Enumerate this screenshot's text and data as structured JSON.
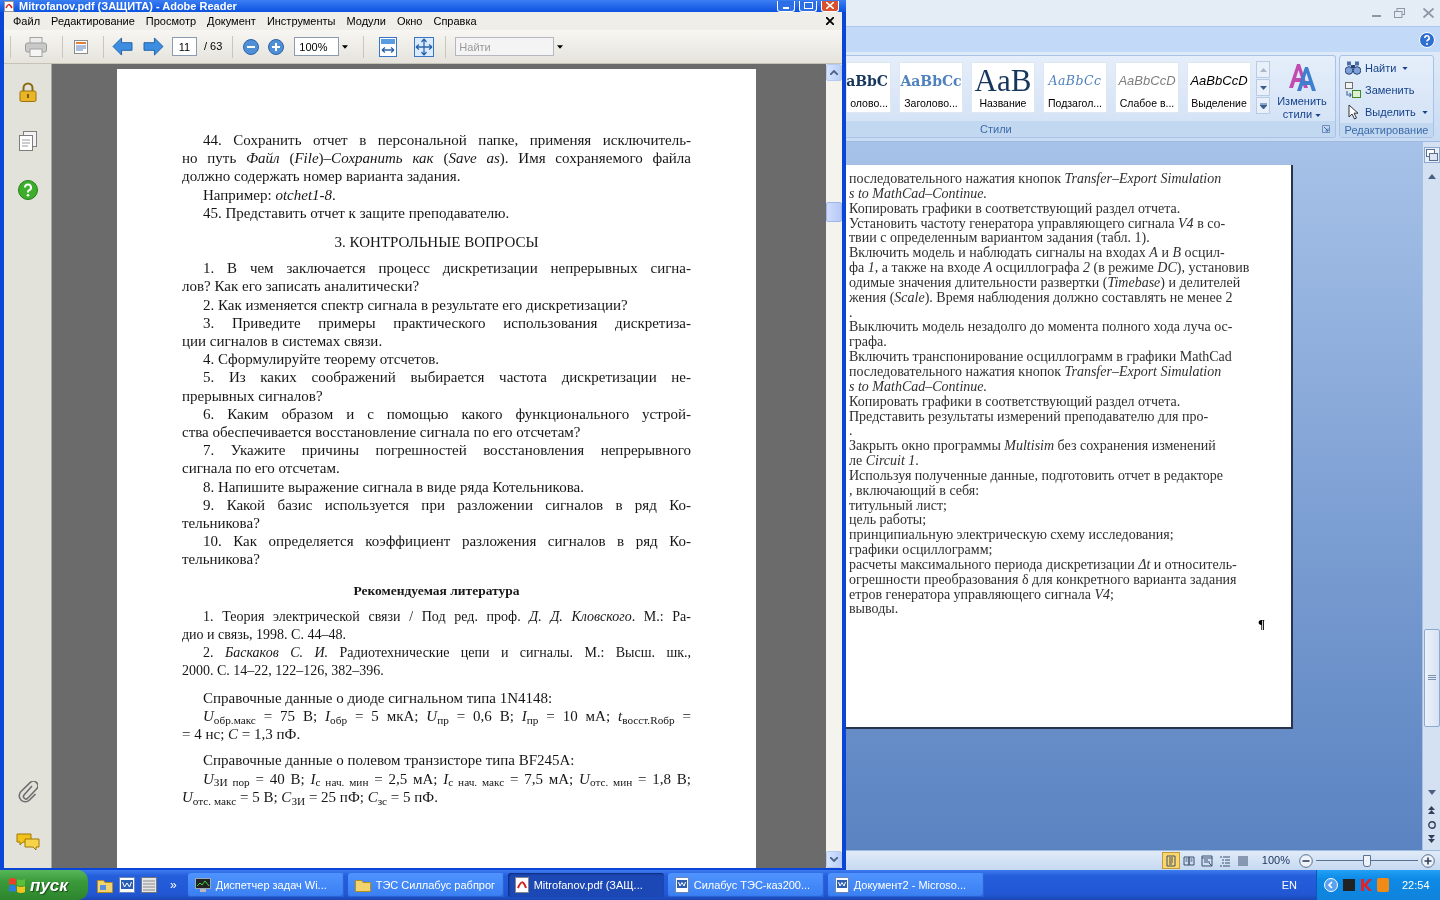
{
  "reader": {
    "title": "Mitrofanov.pdf (ЗАЩИТА) - Adobe Reader",
    "menu": [
      "Файл",
      "Редактирование",
      "Просмотр",
      "Документ",
      "Инструменты",
      "Модули",
      "Окно",
      "Справка"
    ],
    "toolbar": {
      "page_number": "11",
      "page_count": "/ 63",
      "zoom": "100%",
      "search": {
        "placeholder": "Найти"
      }
    },
    "page": {
      "blocks": [
        {
          "kind": "paragraph",
          "lines": [
            "44. Сохранить отчет в персональной папке, применяя исключитель-",
            "но путь *Файл* (*File*)–*Сохранить как* (*Save as*). Имя сохраняемого файла",
            "должно содержать номер варианта задания."
          ]
        },
        {
          "kind": "paragraph",
          "lines": [
            "Например: *otchet1-8*."
          ]
        },
        {
          "kind": "paragraph",
          "lines": [
            "45. Представить отчет к защите преподавателю."
          ]
        },
        {
          "kind": "heading",
          "text": "3. КОНТРОЛЬНЫЕ ВОПРОСЫ"
        },
        {
          "kind": "paragraph",
          "lines": [
            "1. В чем заключается процесс дискретизации непрерывных сигна-",
            "лов? Как его записать аналитически?"
          ]
        },
        {
          "kind": "paragraph",
          "lines": [
            "2. Как изменяется спектр сигнала в результате его дискретизации?"
          ]
        },
        {
          "kind": "paragraph",
          "lines": [
            "3. Приведите примеры практического использования дискретиза-",
            "ции сигналов в системах связи."
          ]
        },
        {
          "kind": "paragraph",
          "lines": [
            "4. Сформулируйте теорему отсчетов."
          ]
        },
        {
          "kind": "paragraph",
          "lines": [
            "5. Из каких соображений выбирается частота дискретизации не-",
            "прерывных сигналов?"
          ]
        },
        {
          "kind": "paragraph",
          "lines": [
            "6. Каким образом и с помощью какого функционального устрой-",
            "ства обеспечивается восстановление сигнала по его отсчетам?"
          ]
        },
        {
          "kind": "paragraph",
          "lines": [
            "7. Укажите причины погрешностей восстановления непрерывного",
            "сигнала по его отсчетам."
          ]
        },
        {
          "kind": "paragraph",
          "lines": [
            "8. Напишите выражение сигнала в виде ряда Котельникова."
          ]
        },
        {
          "kind": "paragraph",
          "lines": [
            "9. Какой базис используется при разложении сигналов в ряд Ко-",
            "тельникова?"
          ]
        },
        {
          "kind": "paragraph",
          "lines": [
            "10. Как определяется коэффициент разложения сигналов в ряд Ко-",
            "тельникова?"
          ]
        },
        {
          "kind": "subheading",
          "text": "Рекомендуемая литература"
        },
        {
          "kind": "reference",
          "lines": [
            "1. Теория электрической связи / Под ред. проф. *Д. Д. Кловского*. М.: Ра-",
            "дио и связь, 1998. С. 44–48."
          ]
        },
        {
          "kind": "reference",
          "lines": [
            "2. *Баскаков С. И.* Радиотехнические цепи и сигналы. М.: Высш. шк.,",
            "2000. С. 14–22, 122–126, 382–396."
          ]
        },
        {
          "kind": "datasheet",
          "title": "Справочные данные о диоде сигнальном типа 1N4148:",
          "lines": [
            "*U*$_{обр.макс}$ = 75 В; *I*$_{обр}$ = 5 мкА; *U*$_{пр}$ = 0,6 В; *I*$_{пр}$ = 10 мА; *t*$_{восст.Rобр}$ =",
            "= 4 нс; *C* = 1,3 пФ."
          ]
        },
        {
          "kind": "datasheet",
          "title": "Справочные данные о полевом транзисторе типа BF245A:",
          "lines": [
            "*U*$_{ЗИ пор}$ = 40 В; *I*$_{с нач. мин}$ = 2,5 мА; *I*$_{с нач. макс}$ = 7,5 мА; *U*$_{отс. мин}$ = 1,8 В;",
            "*U*$_{отс. макс}$ = 5 В; *C*$_{ЗИ}$ = 25 пФ; *C*$_{зс}$ = 5 пФ."
          ]
        }
      ]
    }
  },
  "word": {
    "styles": [
      {
        "kind": "heading1",
        "preview": "aBbC",
        "label": "олово..."
      },
      {
        "kind": "heading2",
        "preview": "AaBbCc",
        "label": "Заголово..."
      },
      {
        "kind": "title",
        "preview": "AaB",
        "label": "Название"
      },
      {
        "kind": "subtitle",
        "preview": "AaBbCc",
        "label": "Подзагол..."
      },
      {
        "kind": "subtle",
        "preview": "AaBbCcD",
        "label": "Слабое в..."
      },
      {
        "kind": "emphasis",
        "preview": "AaBbCcD",
        "label": "Выделение"
      }
    ],
    "change_styles": "Изменить стили",
    "styles_group": "Стили",
    "editing": [
      {
        "kind": "find",
        "label": "Найти",
        "dropdown": true
      },
      {
        "kind": "replace",
        "label": "Заменить",
        "dropdown": false
      },
      {
        "kind": "select",
        "label": "Выделить",
        "dropdown": true
      }
    ],
    "editing_group": "Редактирование",
    "document": {
      "lines": [
        {
          "text": "последовательного нажатия кнопок *Transfer–Export Simulation*",
          "italic": false
        },
        {
          "text": "s to MathCad–Continue.",
          "italic": true
        },
        {
          "text": "Копировать графики в соответствующий раздел отчета.",
          "italic": false
        },
        {
          "text": "Установить частоту генератора управляющего сигнала *V4* в со-",
          "italic": false
        },
        {
          "text": "твии с определенным вариантом задания (табл. 1).",
          "italic": false
        },
        {
          "text": "Включить модель и наблюдать сигналы на входах *A* и *B* осцил-",
          "italic": false
        },
        {
          "text": "фа *1*, а также на входе *A* осциллографа *2* (в режиме *DC*), установив",
          "italic": false
        },
        {
          "text": "одимые значения длительности развертки (*Timebase*) и делителей",
          "italic": false
        },
        {
          "text": "жения (*Scale*). Время наблюдения должно составлять не менее 2",
          "italic": false
        },
        {
          "text": ".",
          "italic": false
        },
        {
          "text": "Выключить модель незадолго до момента полного хода луча ос-",
          "italic": false
        },
        {
          "text": "графа.",
          "italic": false
        },
        {
          "text": "Включить транспонирование осциллограмм в графики MathCad",
          "italic": false
        },
        {
          "text": "последовательного нажатия кнопок *Transfer–Export Simulation*",
          "italic": false
        },
        {
          "text": "s to MathCad–Continue.",
          "italic": true
        },
        {
          "text": "Копировать графики в соответствующий раздел отчета.",
          "italic": false
        },
        {
          "text": "Представить результаты измерений преподавателю для про-",
          "italic": false
        },
        {
          "text": ".",
          "italic": false
        },
        {
          "text": "Закрыть окно программы *Multisim* без сохранения изменений",
          "italic": false
        },
        {
          "text": "ле *Circuit 1*.",
          "italic": false
        },
        {
          "text": "Используя полученные данные, подготовить отчет в редакторе",
          "italic": false
        },
        {
          "text": ", включающий в себя:",
          "italic": false
        },
        {
          "text": "титульный лист;",
          "italic": false
        },
        {
          "text": "цель работы;",
          "italic": false
        },
        {
          "text": "принципиальную электрическую схему исследования;",
          "italic": false
        },
        {
          "text": "графики осциллограмм;",
          "italic": false
        },
        {
          "text": "расчеты максимального периода дискретизации *Δt* и относитель-",
          "italic": false
        },
        {
          "text": "огрешности преобразования δ для конкретного варианта задания",
          "italic": false
        },
        {
          "text": "етров генератора управляющего сигнала *V4*;",
          "italic": false
        },
        {
          "text": "выводы.",
          "italic": false
        }
      ],
      "paragraph_mark": "¶"
    },
    "status": {
      "views": [
        {
          "kind": "print_layout",
          "selected": true
        },
        {
          "kind": "reading",
          "selected": false
        },
        {
          "kind": "web",
          "selected": false
        },
        {
          "kind": "outline",
          "selected": false
        },
        {
          "kind": "draft",
          "selected": false
        }
      ],
      "zoom": "100%",
      "zoom_slider": {
        "level": 0.5
      }
    }
  },
  "taskbar": {
    "start": "пуск",
    "more": "»",
    "tasks": [
      {
        "kind": "monitor",
        "label": "Диспетчер задач Wi...",
        "selected": false
      },
      {
        "kind": "folder",
        "label": "ТЭС Силлабус рабпрог",
        "selected": false
      },
      {
        "kind": "pdf",
        "label": "Mitrofanov.pdf (ЗАЩ...",
        "selected": true
      },
      {
        "kind": "word",
        "label": "Силабус ТЭС-каз200...",
        "selected": false
      },
      {
        "kind": "word",
        "label": "Документ2 - Microso...",
        "selected": false
      }
    ],
    "language": "EN",
    "clock": "22:54"
  }
}
